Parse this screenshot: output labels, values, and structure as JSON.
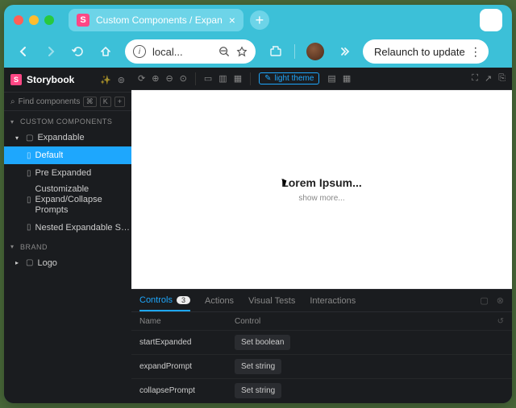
{
  "browser": {
    "tab": {
      "title": "Custom Components / Expan"
    },
    "address": "local...",
    "relaunch": "Relaunch to update"
  },
  "sidebar": {
    "app_name": "Storybook",
    "search_placeholder": "Find components",
    "search_kbd1": "⌘",
    "search_kbd2": "K",
    "sections": [
      {
        "title": "CUSTOM COMPONENTS",
        "items": [
          {
            "label": "Expandable",
            "expanded": true,
            "children": [
              {
                "label": "Default",
                "active": true
              },
              {
                "label": "Pre Expanded"
              },
              {
                "label": "Customizable Expand/Collapse Prompts"
              },
              {
                "label": "Nested Expandable Sections"
              }
            ]
          }
        ]
      },
      {
        "title": "BRAND",
        "items": [
          {
            "label": "Logo",
            "expanded": false
          }
        ]
      }
    ]
  },
  "canvas": {
    "theme_label": "light theme",
    "story_title": "Lorem Ipsum...",
    "show_more": "show more..."
  },
  "addons": {
    "tabs": [
      {
        "label": "Controls",
        "badge": "3",
        "active": true
      },
      {
        "label": "Actions"
      },
      {
        "label": "Visual Tests"
      },
      {
        "label": "Interactions"
      }
    ],
    "columns": {
      "name": "Name",
      "control": "Control"
    },
    "rows": [
      {
        "name": "startExpanded",
        "control": "Set boolean"
      },
      {
        "name": "expandPrompt",
        "control": "Set string"
      },
      {
        "name": "collapsePrompt",
        "control": "Set string"
      }
    ]
  }
}
